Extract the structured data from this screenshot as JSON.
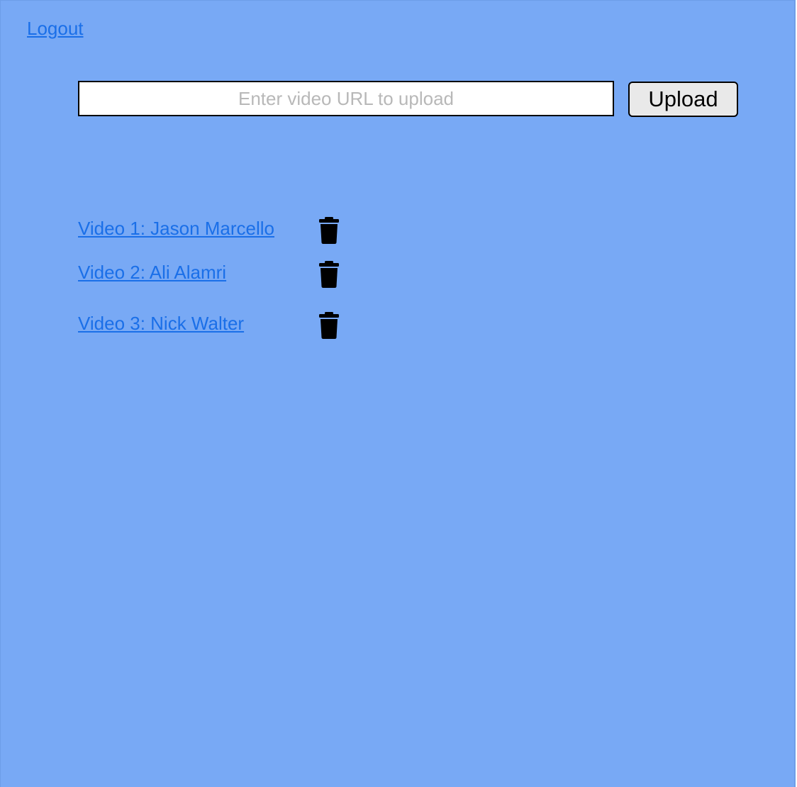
{
  "header": {
    "logout_label": "Logout"
  },
  "upload": {
    "url_value": "",
    "url_placeholder": "Enter video URL to upload",
    "button_label": "Upload"
  },
  "videos": [
    {
      "label": "Video 1: Jason Marcello",
      "delete_icon": "trash-icon"
    },
    {
      "label": "Video 2: Ali Alamri",
      "delete_icon": "trash-icon"
    },
    {
      "label": "Video 3: Nick Walter",
      "delete_icon": "trash-icon"
    }
  ],
  "colors": {
    "background": "#78a9f5",
    "link": "#1a6fe8",
    "button_bg": "#e9e9e9",
    "placeholder": "#b8b8b8"
  }
}
